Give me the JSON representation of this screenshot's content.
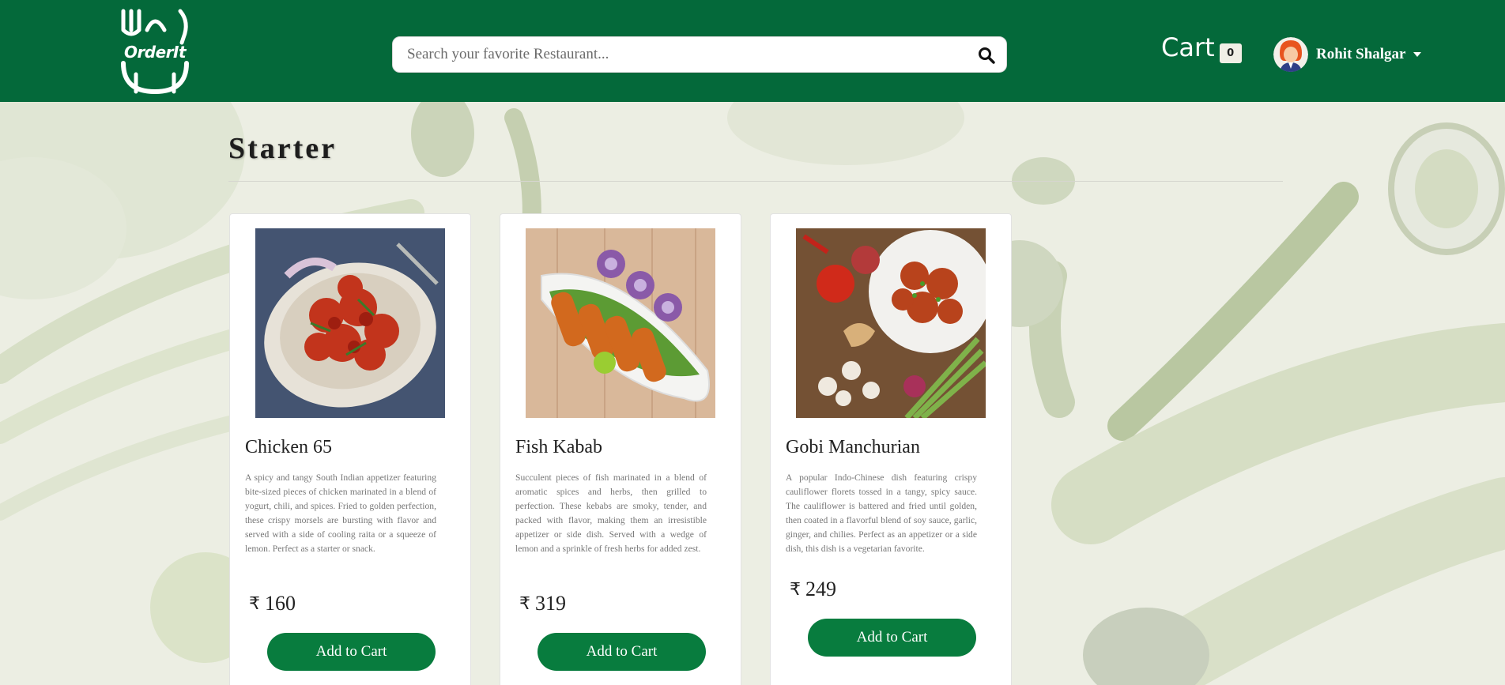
{
  "brand": {
    "logo_text": "OrderIt"
  },
  "header": {
    "search": {
      "placeholder": "Search your favorite Restaurant...",
      "value": ""
    },
    "cart": {
      "label": "Cart",
      "count": "0"
    },
    "user": {
      "name": "Rohit Shalgar"
    }
  },
  "section": {
    "title": "Starter"
  },
  "currency_symbol": "₹",
  "menu_items": [
    {
      "name": "Chicken 65",
      "description": "A spicy and tangy South Indian appetizer featuring bite-sized pieces of chicken marinated in a blend of yogurt, chili, and spices. Fried to golden perfection, these crispy morsels are bursting with flavor and served with a side of cooling raita or a squeeze of lemon. Perfect as a starter or snack.",
      "price": "160",
      "button_label": "Add to Cart"
    },
    {
      "name": "Fish Kabab",
      "description": "Succulent pieces of fish marinated in a blend of aromatic spices and herbs, then grilled to perfection. These kebabs are smoky, tender, and packed with flavor, making them an irresistible appetizer or side dish. Served with a wedge of lemon and a sprinkle of fresh herbs for added zest.",
      "price": "319",
      "button_label": "Add to Cart"
    },
    {
      "name": "Gobi Manchurian",
      "description": "A popular Indo-Chinese dish featuring crispy cauliflower florets tossed in a tangy, spicy sauce. The cauliflower is battered and fried until golden, then coated in a flavorful blend of soy sauce, garlic, ginger, and chilies. Perfect as an appetizer or a side dish, this dish is a vegetarian favorite.",
      "price": "249",
      "button_label": "Add to Cart"
    }
  ],
  "colors": {
    "header_bg": "#04693a",
    "button_bg": "#087c3e",
    "page_bg": "#eeefe6"
  },
  "icons": {
    "search": "search-icon",
    "caret": "chevron-down-icon"
  }
}
